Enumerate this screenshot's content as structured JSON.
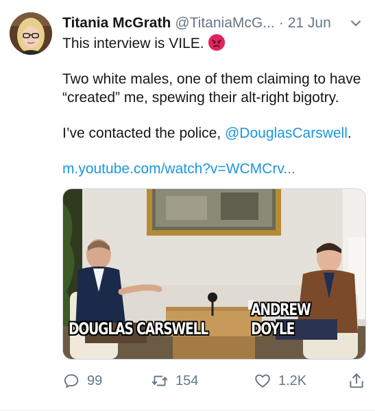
{
  "tweet": {
    "author_name": "Titania McGrath",
    "author_handle": "@TitaniaMcG...",
    "separator": "·",
    "timestamp": "21 Jun",
    "line1": "This interview is VILE.",
    "line2": "Two white males, one of them claiming to have “created” me, spewing their alt-right bigotry.",
    "line3_prefix": "I’ve contacted the police, ",
    "line3_mention": "@DouglasCarswell",
    "line3_suffix": ".",
    "url": "m.youtube.com/watch?v=WCMCrv..."
  },
  "media": {
    "caption_left": "DOUGLAS CARSWELL",
    "caption_right": "ANDREW DOYLE"
  },
  "actions": {
    "replies": "99",
    "retweets": "154",
    "likes": "1.2K"
  },
  "icons": {
    "emoji": "angry-face-icon",
    "menu": "chevron-down-icon",
    "reply": "reply-icon",
    "retweet": "retweet-icon",
    "like": "heart-icon",
    "share": "share-icon"
  },
  "colors": {
    "link": "#1b95e0",
    "secondary": "#657786",
    "text": "#14171a"
  }
}
